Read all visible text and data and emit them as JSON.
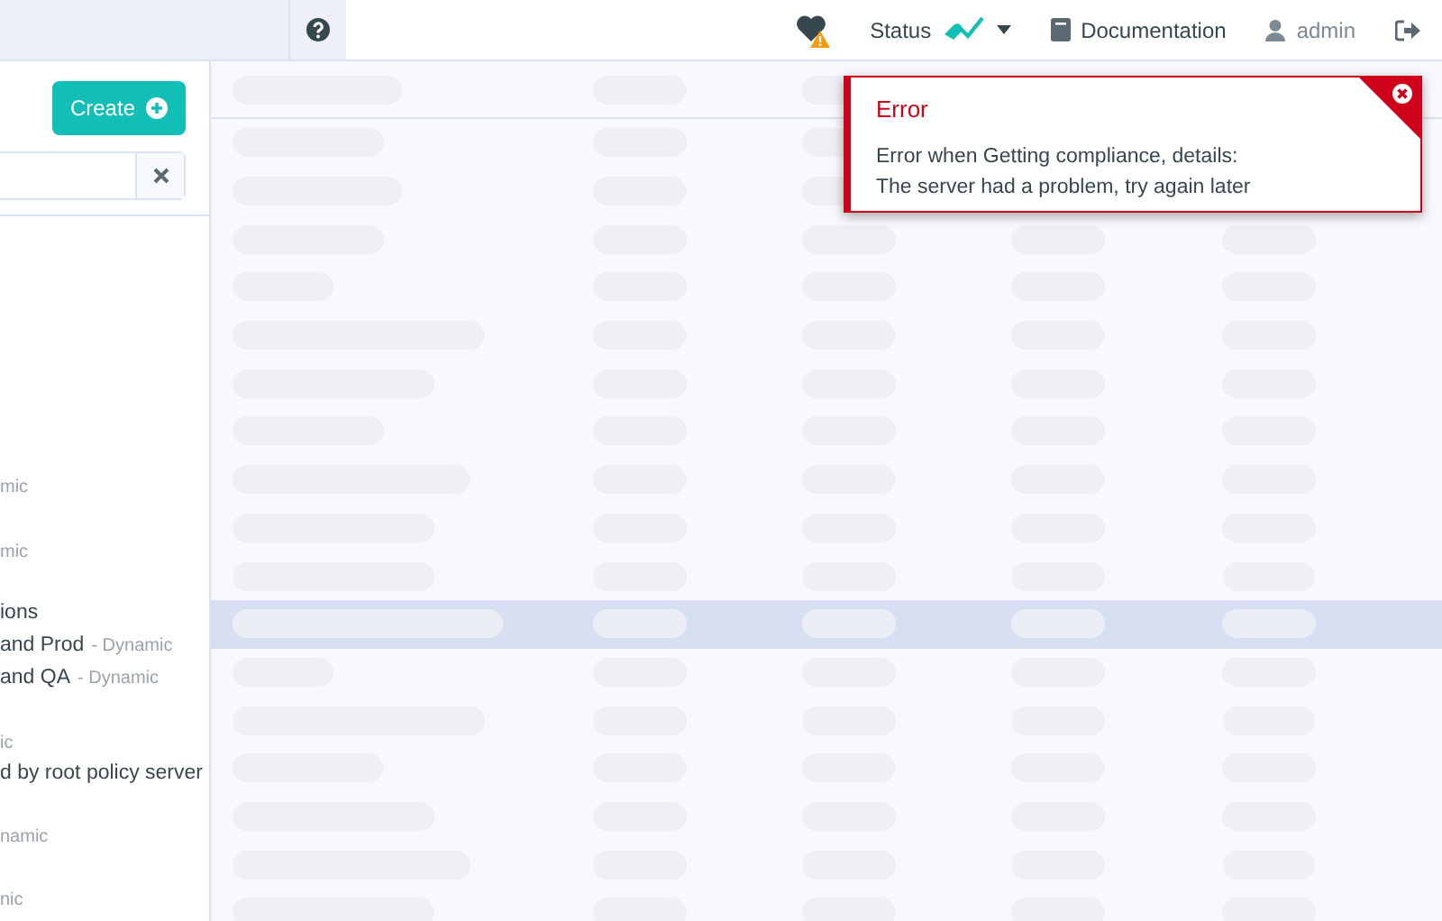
{
  "navbar": {
    "items": [
      {
        "kind": "health"
      },
      {
        "kind": "status",
        "label": "Status"
      },
      {
        "kind": "link",
        "label": "Documentation"
      },
      {
        "kind": "user",
        "label": "admin"
      },
      {
        "kind": "logout"
      }
    ]
  },
  "sidebar": {
    "create_button": "Create",
    "tree": [
      {
        "text": "mic"
      },
      {
        "text": "mic"
      },
      {
        "text": "ions"
      },
      {
        "text": "and Prod",
        "suffix": "- Dynamic"
      },
      {
        "text": "and QA",
        "suffix": "- Dynamic"
      },
      {
        "text": "ic"
      },
      {
        "text": "d by root policy server"
      },
      {
        "text": "namic"
      },
      {
        "text": "nic"
      }
    ]
  },
  "table": {
    "rows": [
      {
        "selected": false
      },
      {
        "selected": false
      },
      {
        "selected": false
      },
      {
        "selected": false
      },
      {
        "selected": false
      },
      {
        "selected": false
      },
      {
        "selected": false
      },
      {
        "selected": false
      },
      {
        "selected": false
      },
      {
        "selected": false
      },
      {
        "selected": true
      },
      {
        "selected": false
      },
      {
        "selected": false
      },
      {
        "selected": false
      },
      {
        "selected": false
      },
      {
        "selected": false
      },
      {
        "selected": false
      }
    ]
  },
  "toast": {
    "title": "Error",
    "lines": [
      "Error when Getting compliance, details:",
      "The server had a problem, try again later"
    ]
  }
}
